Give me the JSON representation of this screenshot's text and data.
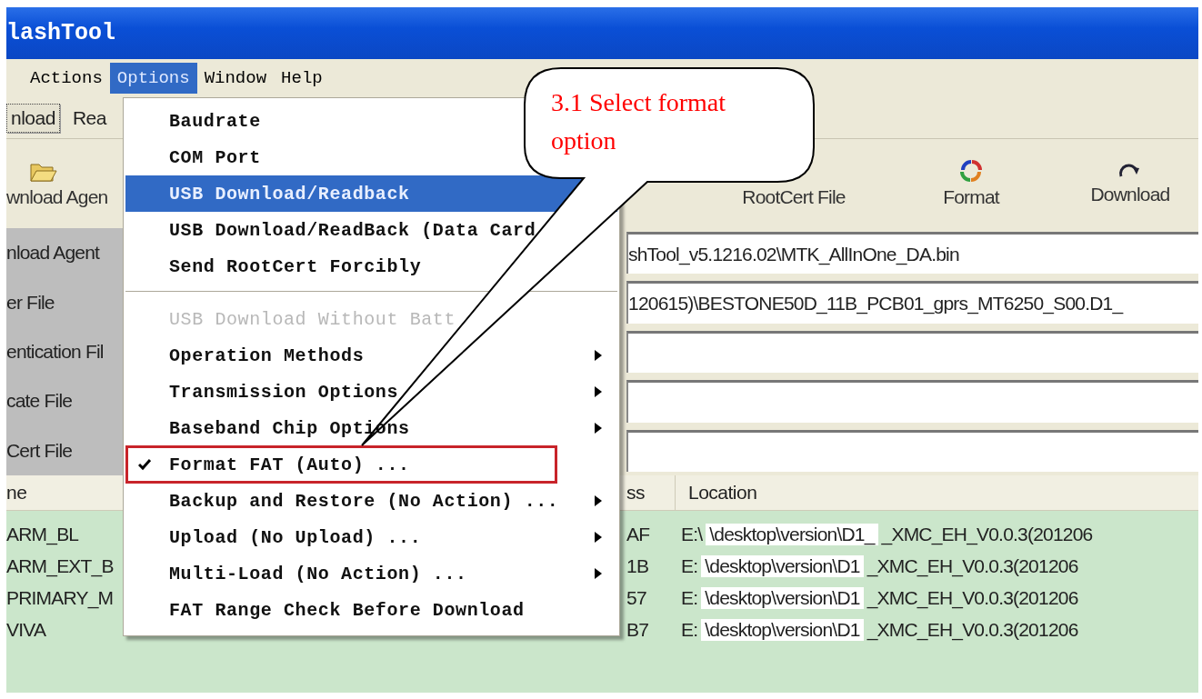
{
  "window": {
    "title": "lashTool"
  },
  "menu_bar": [
    {
      "label": "Actions",
      "selected": false
    },
    {
      "label": "Options",
      "selected": true
    },
    {
      "label": "Window",
      "selected": false
    },
    {
      "label": "Help",
      "selected": false
    }
  ],
  "tabs": [
    {
      "label": "nload",
      "selected": true
    },
    {
      "label": "Rea",
      "selected": false
    }
  ],
  "toolbar": [
    {
      "label": "wnload Agen",
      "kind": "open"
    },
    {
      "label": "RootCert File",
      "kind": "plain"
    },
    {
      "label": "Format",
      "kind": "format"
    },
    {
      "label": "Download",
      "kind": "download"
    }
  ],
  "file_fields": [
    {
      "label": "nload Agent",
      "value": "shTool_v5.1216.02\\MTK_AllInOne_DA.bin"
    },
    {
      "label": "er File",
      "value": "120615)\\BESTONE50D_11B_PCB01_gprs_MT6250_S00.D1_"
    },
    {
      "label": "entication Fil"
    },
    {
      "label": "cate File"
    },
    {
      "label": "Cert File"
    }
  ],
  "table": {
    "columns": [
      "ne",
      "ss",
      "Location"
    ],
    "rows": [
      {
        "name": "ARM_BL",
        "address": "AF",
        "drive": "E:\\",
        "path": "\\desktop\\version\\D1_",
        "file": "_XMC_EH_V0.0.3(201206"
      },
      {
        "name": "ARM_EXT_B",
        "address": "1B",
        "drive": "E:",
        "path": "\\desktop\\version\\D1",
        "file": "_XMC_EH_V0.0.3(201206"
      },
      {
        "name": "PRIMARY_M",
        "address": "57",
        "drive": "E:",
        "path": "\\desktop\\version\\D1",
        "file": "_XMC_EH_V0.0.3(201206"
      },
      {
        "name": "VIVA",
        "address": "B7",
        "drive": "E:",
        "path": "\\desktop\\version\\D1",
        "file": "_XMC_EH_V0.0.3(201206"
      }
    ]
  },
  "options_menu": {
    "items": [
      {
        "kind": "item",
        "label": "Baudrate",
        "selected": false,
        "checked": false,
        "disabled": false,
        "submenu": false
      },
      {
        "kind": "item",
        "label": "COM Port",
        "selected": false,
        "checked": false,
        "disabled": false,
        "submenu": false
      },
      {
        "kind": "item",
        "label": "USB Download/Readback",
        "selected": true,
        "checked": false,
        "disabled": false,
        "submenu": false
      },
      {
        "kind": "item",
        "label": "USB Download/ReadBack (Data Card",
        "selected": false,
        "checked": false,
        "disabled": false,
        "submenu": false
      },
      {
        "kind": "item",
        "label": "Send RootCert Forcibly",
        "selected": false,
        "checked": false,
        "disabled": false,
        "submenu": false
      },
      {
        "kind": "separator"
      },
      {
        "kind": "item",
        "label": "USB Download Without Batt",
        "selected": false,
        "checked": false,
        "disabled": true,
        "submenu": false
      },
      {
        "kind": "item",
        "label": "Operation Methods",
        "selected": false,
        "checked": false,
        "disabled": false,
        "submenu": true
      },
      {
        "kind": "item",
        "label": "Transmission Options",
        "selected": false,
        "checked": false,
        "disabled": false,
        "submenu": true
      },
      {
        "kind": "item",
        "label": "Baseband Chip Options",
        "selected": false,
        "checked": false,
        "disabled": false,
        "submenu": true
      },
      {
        "kind": "item",
        "label": "Format FAT (Auto) ...",
        "selected": false,
        "checked": true,
        "disabled": false,
        "submenu": false,
        "annotated": true
      },
      {
        "kind": "item",
        "label": "Backup and Restore (No Action) ...",
        "selected": false,
        "checked": false,
        "disabled": false,
        "submenu": true
      },
      {
        "kind": "item",
        "label": "Upload (No Upload) ...",
        "selected": false,
        "checked": false,
        "disabled": false,
        "submenu": true
      },
      {
        "kind": "item",
        "label": "Multi-Load (No Action) ...",
        "selected": false,
        "checked": false,
        "disabled": false,
        "submenu": true
      },
      {
        "kind": "item",
        "label": "FAT Range Check Before Download",
        "selected": false,
        "checked": false,
        "disabled": false,
        "submenu": false
      }
    ]
  },
  "callout": {
    "text": "3.1 Select format option"
  }
}
